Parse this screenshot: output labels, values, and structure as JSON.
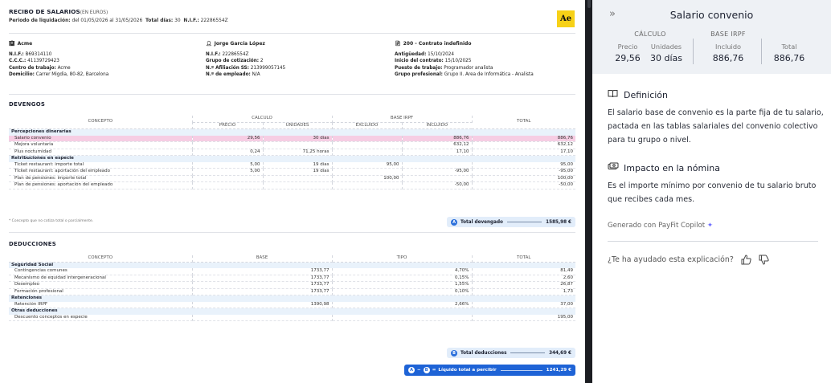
{
  "slip": {
    "title": "RECIBO DE SALARIOS",
    "title_sub": "(EN EUROS)",
    "period_label": "Periodo de liquidación:",
    "period_value": "del 01/05/2026 al 31/05/2026",
    "days_label": "Total días:",
    "days_value": "30",
    "nif_label": "N.I.F.:",
    "nif_value": "22286554Z",
    "logo_text": "Ae",
    "company": {
      "name": "Acme",
      "lines": [
        {
          "k": "N.I.F.:",
          "v": "B69314110"
        },
        {
          "k": "C.C.C.:",
          "v": "41139729423"
        },
        {
          "k": "Centro de trabajo:",
          "v": "Acme"
        },
        {
          "k": "Domicilio:",
          "v": "Carrer Migdia, 80-82, Barcelona"
        }
      ]
    },
    "employee": {
      "name": "Jorge García López",
      "lines": [
        {
          "k": "N.I.F.:",
          "v": "22286554Z"
        },
        {
          "k": "Grupo de cotización:",
          "v": "2"
        },
        {
          "k": "N.º Afiliación SS:",
          "v": "213999057145"
        },
        {
          "k": "N.º de empleado:",
          "v": "N/A"
        }
      ]
    },
    "contract": {
      "name": "200 - Contrato indefinido",
      "lines": [
        {
          "k": "Antigüedad:",
          "v": "15/10/2024"
        },
        {
          "k": "Inicio del contrato:",
          "v": "15/10/2025"
        },
        {
          "k": "Puesto de trabajo:",
          "v": "Programador analista"
        },
        {
          "k": "Grupo profesional:",
          "v": "Grupo II. Area de Informática - Analista"
        }
      ]
    },
    "devengos": {
      "title": "DEVENGOS",
      "h_concepto": "CONCEPTO",
      "h_calculo": "CÁLCULO",
      "h_precio": "PRECIO",
      "h_unidades": "UNIDADES",
      "h_base": "BASE IRPF",
      "h_excluido": "EXCLUIDO",
      "h_incluido": "INCLUIDO",
      "h_total": "TOTAL",
      "groups": [
        {
          "name": "Percepciones dinerarias",
          "rows": [
            {
              "c": "Salario convenio",
              "p": "29,56",
              "u": "30 días",
              "e": "",
              "i": "886,76",
              "t": "886,76"
            },
            {
              "c": "Mejora voluntaria",
              "p": "",
              "u": "",
              "e": "",
              "i": "632,12",
              "t": "632,12"
            },
            {
              "c": "Plus nocturnidad",
              "p": "0,24",
              "u": "71,25 horas",
              "e": "",
              "i": "17,10",
              "t": "17,10"
            }
          ]
        },
        {
          "name": "Retribuciones en especie",
          "rows": [
            {
              "c": "Ticket restaurant: importe total",
              "p": "5,00",
              "u": "19 días",
              "e": "95,00",
              "i": "",
              "t": "95,00"
            },
            {
              "c": "Ticket restaurant: aportación del empleado",
              "p": "5,00",
              "u": "19 días",
              "e": "",
              "i": "-95,00",
              "t": "-95,00"
            },
            {
              "c": "Plan de pensiones: importe total",
              "p": "",
              "u": "",
              "e": "100,00",
              "i": "",
              "t": "100,00"
            },
            {
              "c": "Plan de pensiones: aportación del empleado",
              "p": "",
              "u": "",
              "e": "",
              "i": "-50,00",
              "t": "-50,00"
            }
          ]
        }
      ],
      "note": "* Concepto que no cotiza total o parcialmente.",
      "total_badge": "A",
      "total_label": "Total devengado",
      "total_value": "1585,98 €"
    },
    "deducciones": {
      "title": "DEDUCCIONES",
      "h_concepto": "CONCEPTO",
      "h_base": "BASE",
      "h_tipo": "TIPO",
      "h_total": "TOTAL",
      "groups": [
        {
          "name": "Seguridad Social",
          "rows": [
            {
              "c": "Contingencias comunes",
              "b": "1733,77",
              "t": "4,70%",
              "v": "81,49"
            },
            {
              "c": "Mecanismo de equidad intergeneracional",
              "b": "1733,77",
              "t": "0,15%",
              "v": "2,60"
            },
            {
              "c": "Desempleo",
              "b": "1733,77",
              "t": "1,55%",
              "v": "26,87"
            },
            {
              "c": "Formación profesional",
              "b": "1733,77",
              "t": "0,10%",
              "v": "1,73"
            }
          ]
        },
        {
          "name": "Retenciones",
          "rows": [
            {
              "c": "Retención IRPF",
              "b": "1390,98",
              "t": "2,66%",
              "v": "37,00"
            }
          ]
        },
        {
          "name": "Otras deducciones",
          "rows": [
            {
              "c": "Descuento conceptos en especie",
              "b": "",
              "t": "",
              "v": "195,00"
            }
          ]
        }
      ],
      "total_badge": "B",
      "total_label": "Total deducciones",
      "total_value": "344,69 €"
    },
    "net": {
      "badge_a": "A",
      "minus": "−",
      "badge_b": "B",
      "equals": "=",
      "label": "Líquido total a percibir",
      "value": "1241,29 €"
    }
  },
  "panel": {
    "collapse_icon": "»",
    "title": "Salario convenio",
    "calc_head": "CÁLCULO",
    "base_head": "BASE IRPF",
    "labels": {
      "precio": "Precio",
      "unidades": "Unidades",
      "incluido": "Incluido",
      "total": "Total"
    },
    "values": {
      "precio": "29,56",
      "unidades": "30 días",
      "incluido": "886,76",
      "total": "886,76"
    },
    "def_title": "Definición",
    "def_text": "El salario base de convenio es la parte fija de tu salario, pactada en las tablas salariales del convenio colectivo para tu grupo o nivel.",
    "impact_title": "Impacto en la nómina",
    "impact_text": "Es el importe mínimo por convenio de tu salario bruto que recibes cada mes.",
    "generated": "Generado con PayFit Copilot",
    "feedback_q": "¿Te ha ayudado esta explicación?"
  }
}
